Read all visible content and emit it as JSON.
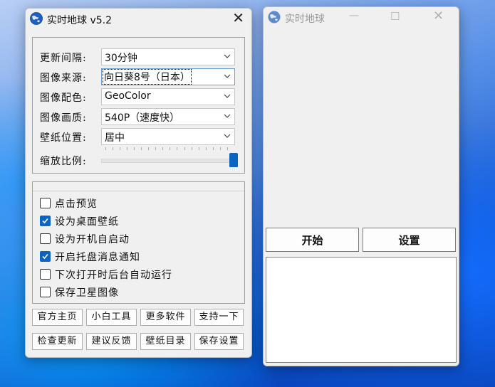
{
  "left_window": {
    "title": "实时地球 v5.2",
    "settings": [
      {
        "label": "更新间隔:",
        "value": "30分钟"
      },
      {
        "label": "图像来源:",
        "value": "向日葵8号（日本）"
      },
      {
        "label": "图像配色:",
        "value": "GeoColor"
      },
      {
        "label": "图像画质:",
        "value": "540P（速度快）"
      },
      {
        "label": "壁纸位置:",
        "value": "居中"
      }
    ],
    "zoom": {
      "label": "缩放比例:",
      "value_fraction": 1.0
    },
    "options": [
      {
        "label": "点击预览",
        "checked": false
      },
      {
        "label": "设为桌面壁纸",
        "checked": true
      },
      {
        "label": "设为开机自启动",
        "checked": false
      },
      {
        "label": "开启托盘消息通知",
        "checked": true
      },
      {
        "label": "下次打开时后台自动运行",
        "checked": false
      },
      {
        "label": "保存卫星图像",
        "checked": false
      }
    ],
    "buttons_row1": [
      "官方主页",
      "小白工具",
      "更多软件",
      "支持一下"
    ],
    "buttons_row2": [
      "检查更新",
      "建议反馈",
      "壁纸目录",
      "保存设置"
    ]
  },
  "right_window": {
    "title": "实时地球",
    "start_label": "开始",
    "settings_label": "设置"
  },
  "colors": {
    "accent": "#0b63c4"
  }
}
